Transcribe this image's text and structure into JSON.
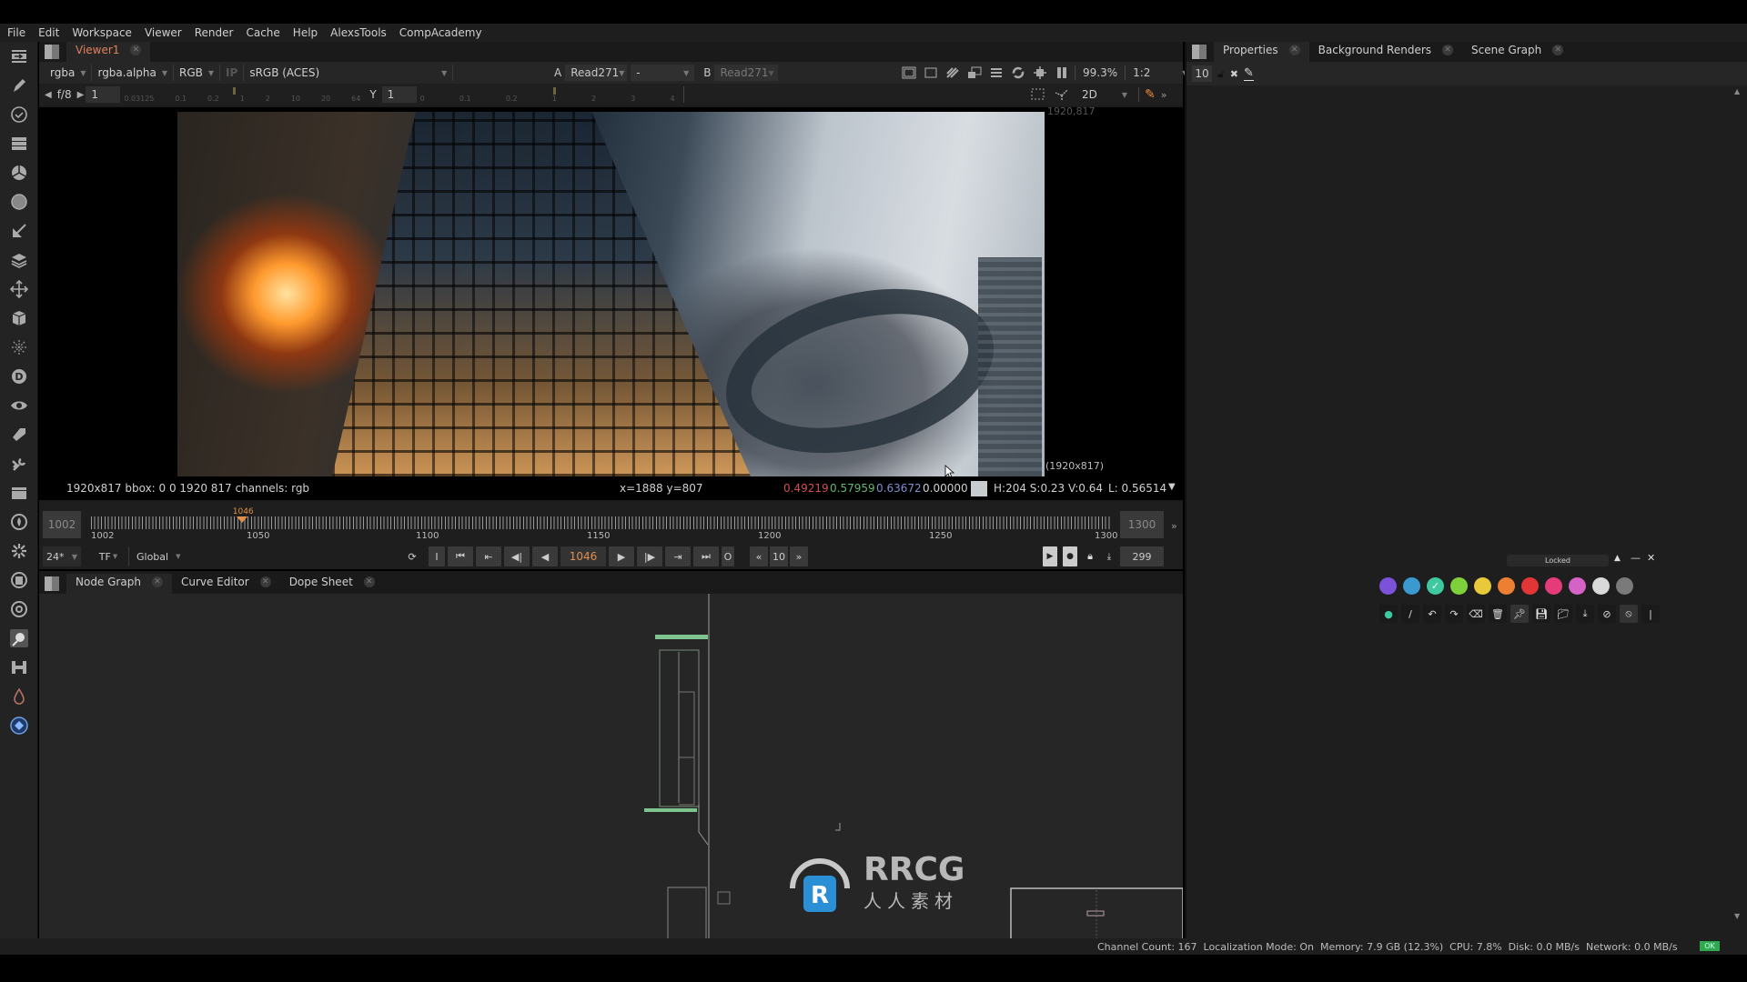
{
  "menu": [
    "File",
    "Edit",
    "Workspace",
    "Viewer",
    "Render",
    "Cache",
    "Help",
    "AlexsTools",
    "CompAcademy"
  ],
  "toolbar_left": {
    "icons": [
      "toolbar-toggle-icon",
      "paint-brush-icon",
      "clock-time-icon",
      "channel-stack-icon",
      "color-wheel-icon",
      "filter-sphere-icon",
      "keyer-icon",
      "merge-layers-icon",
      "transform-move-icon",
      "3d-cube-icon",
      "particles-icon",
      "deep-d-icon",
      "views-eye-icon",
      "metadata-tag-icon",
      "toolsets-wrench-icon",
      "other-box-icon",
      "furnace-icon",
      "pixel-plugin-icon",
      "cara-vr-icon",
      "ocula-icon",
      "compacademy-icon",
      "gizmo-blocks-icon",
      "drop-icon",
      "custom-plugin-icon"
    ]
  },
  "viewer": {
    "tab_label": "Viewer1",
    "channels": "rgba",
    "alpha_channel": "rgba.alpha",
    "display_channels": "RGB",
    "ip_label": "IP",
    "colorspace": "sRGB (ACES)",
    "input_a_label": "A",
    "input_a": "Read271",
    "composite_mode": "-",
    "input_b_label": "B",
    "input_b": "Read271",
    "zoom": "99.3%",
    "proxy": "1:2",
    "fstop_label": "f/8",
    "gain_value": "1",
    "gain_ticks": [
      "0.03125",
      "0.1",
      "0.2",
      "1",
      "2",
      "10",
      "20",
      "64"
    ],
    "gamma_label": "Y",
    "gamma_value": "1",
    "gamma_ticks": [
      "0",
      "0.1",
      "0.2",
      "1",
      "2",
      "3",
      "4"
    ],
    "view_mode": "2D",
    "format_top": "1920,817",
    "format_bottom": "(1920x817)",
    "info": {
      "format": "1920x817  bbox: 0 0 1920 817 channels: rgb",
      "coords": "x=1888 y=807",
      "r": "0.49219",
      "g": "0.57959",
      "b": "0.63672",
      "a": "0.00000",
      "hsv": "H:204 S:0.23 V:0.64",
      "luma": "L: 0.56514",
      "swatch_color": "#c7ccd1"
    }
  },
  "timeline": {
    "in_frame": "1002",
    "out_frame": "1300",
    "current_marker": "1046",
    "ticks": [
      "1002",
      "1050",
      "1100",
      "1150",
      "1200",
      "1250",
      "1300"
    ],
    "fps": "24*",
    "tf_label": "TF",
    "range_mode": "Global",
    "current_frame": "1046",
    "increment": "10",
    "frame_count": "299",
    "playhead_fraction": 0.148
  },
  "bottom_tabs": [
    {
      "label": "Node Graph",
      "active": true
    },
    {
      "label": "Curve Editor",
      "active": false
    },
    {
      "label": "Dope Sheet",
      "active": false
    }
  ],
  "right_tabs": [
    {
      "label": "Properties",
      "active": true
    },
    {
      "label": "Background Renders",
      "active": false
    },
    {
      "label": "Scene Graph",
      "active": false
    }
  ],
  "properties": {
    "max_panels": "10"
  },
  "annotation_widget": {
    "locked_label": "Locked",
    "colors": [
      "#7b52d9",
      "#3a9ad0",
      "#3ec9a0",
      "#7fd13b",
      "#e7c93a",
      "#ec7f32",
      "#e23535",
      "#e53b78",
      "#d562c7",
      "#d9d9d9",
      "#7a7a7a"
    ],
    "selected_color_index": 2,
    "tools": [
      "dot-icon",
      "pen-icon",
      "undo-icon",
      "redo-icon",
      "eraser-icon",
      "trash-icon",
      "pin-icon",
      "save-icon",
      "folder-icon",
      "download-icon",
      "hide-icon",
      "clear-icon",
      "separator-icon"
    ]
  },
  "status": {
    "text": "Channel Count: 167  Localization Mode: On  Memory: 7.9 GB (12.3%)  CPU: 7.8%  Disk: 0.0 MB/s  Network: 0.0 MB/s",
    "ok_label": "OK",
    "ok_color": "#2fa84f"
  },
  "watermark": {
    "brand": "RRCG",
    "subtitle": "人人素材"
  }
}
